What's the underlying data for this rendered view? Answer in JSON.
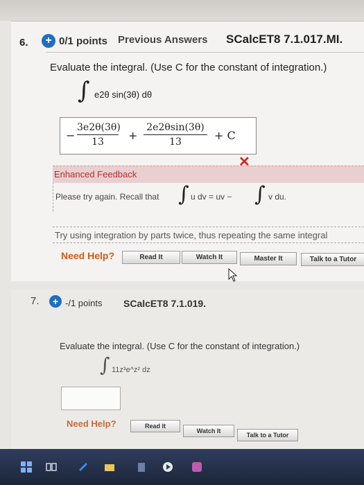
{
  "question6": {
    "number": "6.",
    "plus": "+",
    "points": "0/1 points",
    "previous_answers": "Previous Answers",
    "code": "SCalcET8 7.1.017.MI.",
    "instruction": "Evaluate the integral. (Use C for the constant of integration.)",
    "integral_expr": "e2θ sin(3θ) dθ",
    "answer": {
      "frac1_num": "3e2θ(3θ)",
      "frac1_den": "13",
      "plus": "+",
      "frac2_num": "2e2θsin(3θ)",
      "frac2_den": "13",
      "const": "+ C"
    },
    "incorrect_mark": "✕"
  },
  "feedback": {
    "header": "Enhanced Feedback",
    "text_before": "Please try again. Recall that",
    "formula_part1": "u dv = uv −",
    "formula_part2": "v du.",
    "hint": "Try using integration by parts twice, thus repeating the same integral"
  },
  "help6": {
    "label": "Need Help?",
    "read": "Read It",
    "watch": "Watch It",
    "master": "Master It",
    "tutor": "Talk to a Tutor"
  },
  "question7": {
    "number": "7.",
    "plus": "+",
    "points": "-/1 points",
    "code": "SCalcET8 7.1.019.",
    "instruction": "Evaluate the integral. (Use C for the constant of integration.)",
    "integral_expr": "11z³e^z² dz"
  },
  "help7": {
    "label": "Need Help?",
    "read": "Read It",
    "watch": "Watch It",
    "tutor": "Talk to a Tutor"
  },
  "colors": {
    "accent_blue": "#1f6fc0",
    "incorrect_red": "#d22222",
    "help_orange": "#d15a15",
    "feedback_bg": "#e9cfcf"
  }
}
